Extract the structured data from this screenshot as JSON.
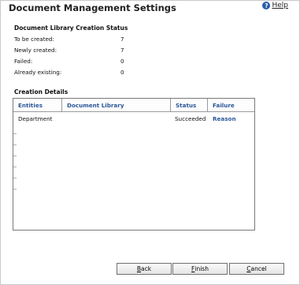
{
  "header": {
    "title": "Document Management Settings",
    "help_label": "Help",
    "help_icon": "question-icon"
  },
  "status_section": {
    "heading": "Document Library Creation Status",
    "rows": [
      {
        "label": "To be created:",
        "value": "7"
      },
      {
        "label": "Newly created:",
        "value": "7"
      },
      {
        "label": "Failed:",
        "value": "0"
      },
      {
        "label": "Already existing:",
        "value": "0"
      }
    ]
  },
  "details_section": {
    "heading": "Creation Details",
    "columns": [
      "Entities",
      "Document Library",
      "Status",
      "Failure Reason"
    ],
    "rows": [
      {
        "entity": "Department",
        "library": "",
        "status": "Succeeded",
        "reason": ""
      }
    ]
  },
  "buttons": {
    "back": {
      "mnemonic": "B",
      "rest": "ack"
    },
    "finish": {
      "mnemonic": "F",
      "rest": "inish"
    },
    "cancel": {
      "mnemonic": "C",
      "rest": "ancel"
    }
  },
  "colors": {
    "column_header_text": "#2b5797",
    "help_icon_bg": "#2a5caa"
  }
}
